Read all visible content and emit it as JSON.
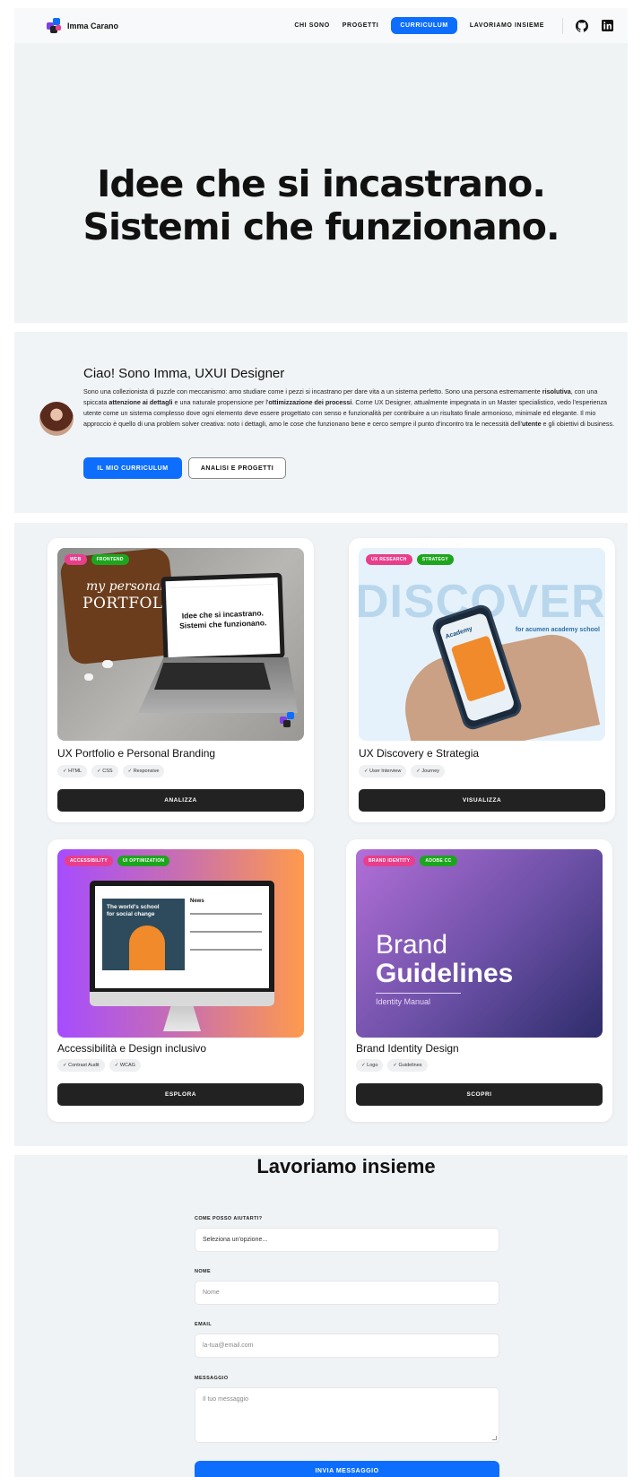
{
  "nav": {
    "brand": "Imma Carano",
    "links": [
      "CHI SONO",
      "PROGETTI",
      "CURRICULUM",
      "LAVORIAMO INSIEME"
    ],
    "icons": [
      "github-icon",
      "linkedin-icon"
    ]
  },
  "hero": {
    "line1": "Idee che si incastrano.",
    "line2": "Sistemi che funzionano."
  },
  "about": {
    "title": "Ciao! Sono Imma, UXUI Designer",
    "text_1": "Sono una collezionista di puzzle con meccanismo: amo studiare come i pezzi si incastrano per dare vita a un sistema perfetto. Sono una persona estremamente ",
    "bold_1": "risolutiva",
    "text_2": ", con una spiccata ",
    "bold_2": "attenzione ai dettagli",
    "text_3": " e una naturale propensione per l'",
    "bold_3": "ottimizzazione dei processi",
    "text_4": ". Come UX Designer, attualmente impegnata in un Master specialistico, vedo l'esperienza utente come un sistema complesso dove ogni elemento deve essere progettato con senso e funzionalità per contribuire a un risultato finale armonioso, minimale ed elegante. Il mio approccio è quello di una problem solver creativa: noto i dettagli, amo le cose che funzionano bene e cerco sempre il punto d'incontro tra le necessità dell'",
    "bold_4": "utente",
    "text_5": " e gli obiettivi di business.",
    "btn_primary": "IL MIO CURRICULUM",
    "btn_secondary": "ANALISI E PROGETTI"
  },
  "projects": [
    {
      "tags": [
        "WEB",
        "FRONTEND"
      ],
      "title": "UX Portfolio e Personal Branding",
      "chips": [
        "✓ HTML",
        "✓ CSS",
        "✓ Responsive"
      ],
      "button": "ANALIZZA",
      "img_script": "my personal",
      "img_caps": "PORTFOLIO",
      "screen_line1": "Idee che si incastrano.",
      "screen_line2": "Sistemi che funzionano."
    },
    {
      "tags": [
        "UX RESEARCH",
        "STRATEGY"
      ],
      "title": "UX Discovery e Strategia",
      "chips": [
        "✓ User Interview",
        "✓ Journey"
      ],
      "button": "VISUALIZZA",
      "img_big": "DISCOVERY",
      "img_sub": "for acumen academy school",
      "phone_brand": "Academy"
    },
    {
      "tags": [
        "ACCESSIBILITY",
        "UI OPTIMIZATION"
      ],
      "title": "Accessibilità e Design inclusivo",
      "chips": [
        "✓ Contrast Audit",
        "✓ WCAG"
      ],
      "button": "ESPLORA",
      "screen_headline": "The world's school for social change",
      "screen_news": "News"
    },
    {
      "tags": [
        "BRAND IDENTITY",
        "ADOBE CC"
      ],
      "title": "Brand Identity Design",
      "chips": [
        "✓ Logo",
        "✓ Guidelines"
      ],
      "button": "SCOPRI",
      "img_line1": "Brand",
      "img_line2": "Guidelines",
      "img_line3": "Identity Manual"
    }
  ],
  "contact": {
    "title": "Lavoriamo insieme",
    "q_label": "COME POSSO AIUTARTI?",
    "q_value": "Seleziona un'opzione...",
    "name_label": "NOME",
    "name_placeholder": "Nome",
    "email_label": "EMAIL",
    "email_placeholder": "la-tua@email.com",
    "msg_label": "MESSAGGIO",
    "msg_placeholder": "Il tuo messaggio",
    "submit": "INVIA MESSAGGIO"
  },
  "colors": {
    "accent": "#0d6efd",
    "tag_pink": "#e83e8c",
    "tag_green": "#1ea51e",
    "dark_button": "#222222"
  }
}
